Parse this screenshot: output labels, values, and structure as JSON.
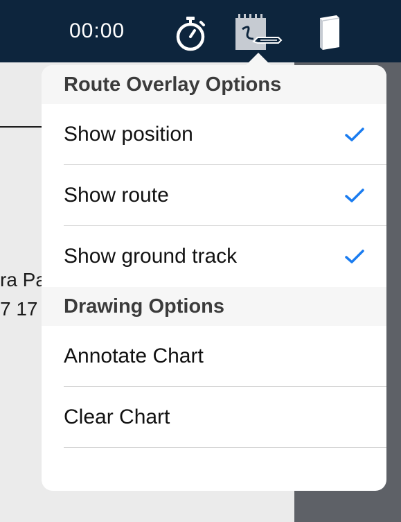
{
  "topbar": {
    "timer": "00:00",
    "icons": [
      "stopwatch-icon",
      "draw-on-chart-icon",
      "book-icon"
    ]
  },
  "background": {
    "chart_text_1": "ra Pa",
    "chart_text_2": "7 17"
  },
  "popover": {
    "sections": [
      {
        "header": "Route Overlay Options",
        "items": [
          {
            "label": "Show position",
            "checked": true
          },
          {
            "label": "Show route",
            "checked": true
          },
          {
            "label": "Show ground track",
            "checked": true
          }
        ]
      },
      {
        "header": "Drawing Options",
        "items": [
          {
            "label": "Annotate Chart"
          },
          {
            "label": "Clear Chart"
          }
        ]
      }
    ]
  },
  "colors": {
    "topbar": "#0d253d",
    "checkmark": "#1a7cf0",
    "section_header_bg": "#f6f6f6"
  }
}
